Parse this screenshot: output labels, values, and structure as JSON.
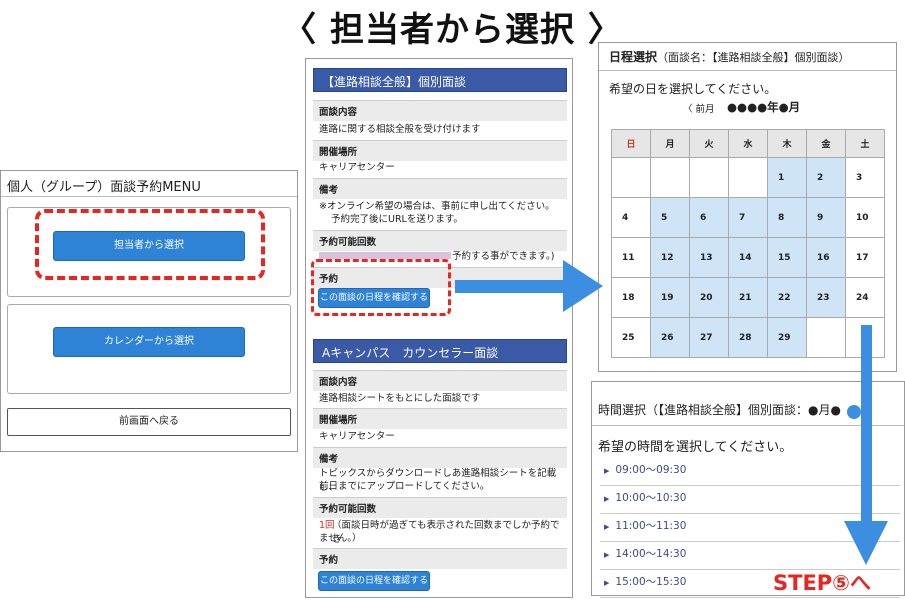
{
  "title": "〈 担当者から選択 〉",
  "panel1": {
    "header": "個人（グループ）面談予約MENU",
    "btn_staff": "担当者から選択",
    "btn_calendar": "カレンダーから選択",
    "btn_back": "前画面へ戻る"
  },
  "panel2": {
    "s1": {
      "head": "【進路相談全般】個別面談",
      "l_content": "面談内容",
      "v_content": "進路に関する相談全般を受け付けます",
      "l_place": "開催場所",
      "v_place": "キャリアセンター",
      "l_note": "備考",
      "v_note1": "※オンライン希望の場合は、事前に申し出てください。",
      "v_note2": "予約完了後にURLを送ります。",
      "l_count": "予約可能回数",
      "v_count": "予約する事ができます。)",
      "l_reserve": "予約",
      "btn": "この面談の日程を確認する"
    },
    "s2": {
      "head": "Aキャンパス　カウンセラー面談",
      "l_content": "面談内容",
      "v_content": "進路相談シートをもとにした面談です",
      "l_place": "開催場所",
      "v_place": "キャリアセンター",
      "l_note": "備考",
      "v_note1": "トピックスからダウンロードしあ進路相談シートを記載し、",
      "v_note2": "前日までにアップロードしてください。",
      "l_count": "予約可能回数",
      "v_count_red": "1回",
      "v_count1": "（面談日時が過ぎても表示された回数までしか予約でき",
      "v_count2": "ません。）",
      "l_reserve": "予約",
      "btn": "この面談の日程を確認する"
    }
  },
  "panel3": {
    "header": "日程選択",
    "header_sub": "（面談名：【進路相談全般】個別面談）",
    "prompt": "希望の日を選択してください。",
    "prev": "〈 前月",
    "month": "●●●●年●月",
    "weekdays": [
      "日",
      "月",
      "火",
      "水",
      "木",
      "金",
      "土"
    ],
    "rows": [
      [
        "",
        "",
        "",
        "",
        "1",
        "2",
        "3"
      ],
      [
        "4",
        "5",
        "6",
        "7",
        "8",
        "9",
        "10"
      ],
      [
        "11",
        "12",
        "13",
        "14",
        "15",
        "16",
        "17"
      ],
      [
        "18",
        "19",
        "20",
        "21",
        "22",
        "23",
        "24"
      ],
      [
        "25",
        "26",
        "27",
        "28",
        "29",
        "",
        ""
      ]
    ],
    "available": [
      [
        false,
        false,
        false,
        false,
        true,
        true,
        false
      ],
      [
        false,
        true,
        true,
        true,
        true,
        true,
        false
      ],
      [
        false,
        true,
        true,
        true,
        true,
        true,
        false
      ],
      [
        false,
        true,
        true,
        true,
        true,
        true,
        false
      ],
      [
        false,
        true,
        true,
        true,
        true,
        false,
        false
      ]
    ]
  },
  "panel4": {
    "header": "時間選択（【進路相談全般】個別面談：●月●",
    "prompt": "希望の時間を選択してください。",
    "slots": [
      "09:00～09:30",
      "10:00～10:30",
      "11:00～11:30",
      "14:00～14:30",
      "15:00～15:30"
    ]
  },
  "step": "STEP⑤へ",
  "colors": {
    "accent_red": "#e8251f",
    "button_blue": "#2f83d6",
    "header_navy": "#3a5aa8",
    "arrow_blue": "#3b8ee0",
    "calendar_available": "#cfe4f7"
  }
}
